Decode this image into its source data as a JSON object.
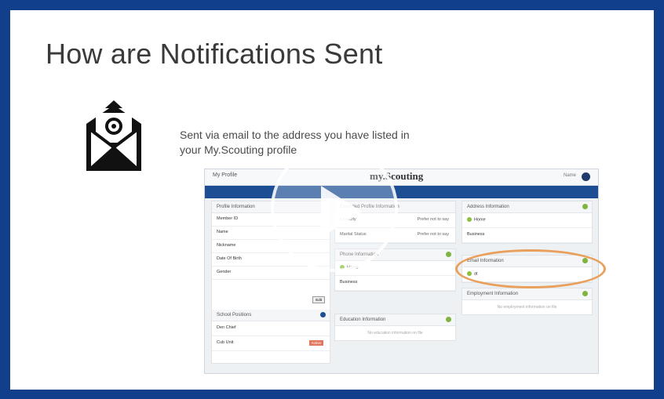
{
  "slide": {
    "title": "How are Notifications Sent",
    "description": "Sent via email to the address you have listed in your My.Scouting profile"
  },
  "colors": {
    "frame": "#123f8c",
    "band": "#1d4e94",
    "highlight": "#e8a05c"
  },
  "icons": {
    "envelope": "email-envelope-icon",
    "play": "play-icon"
  },
  "screenshot": {
    "topbar": {
      "left": "My Profile",
      "brand": "my.Scouting",
      "user": "Name"
    },
    "profile_info": {
      "header": "Profile Information",
      "fields": [
        "Member ID",
        "Name",
        "Nickname",
        "Date Of Birth",
        "Gender"
      ],
      "button": "Edit"
    },
    "school": {
      "header": "School Positions",
      "rows": [
        {
          "label": "Den Chief",
          "tag": ""
        },
        {
          "label": "Cub Unit",
          "tag": "Active"
        }
      ]
    },
    "extended_profile": {
      "header": "Extended Profile Information",
      "rows": [
        {
          "label": "Ethnicity",
          "value": "Prefer not to say"
        },
        {
          "label": "Marital Status",
          "value": "Prefer not to say"
        }
      ]
    },
    "phone_info": {
      "header": "Phone Information",
      "rows": [
        {
          "label": "Home",
          "value": ""
        },
        {
          "label": "Business",
          "value": ""
        }
      ]
    },
    "education": {
      "header": "Education Information",
      "empty": "No education information on file"
    },
    "address": {
      "header": "Address Information",
      "rows": [
        {
          "label": "Home",
          "value": ""
        },
        {
          "label": "Business",
          "value": ""
        }
      ]
    },
    "email": {
      "header": "Email Information",
      "row": "at"
    },
    "employment": {
      "header": "Employment Information",
      "empty": "No employment information on file"
    }
  }
}
